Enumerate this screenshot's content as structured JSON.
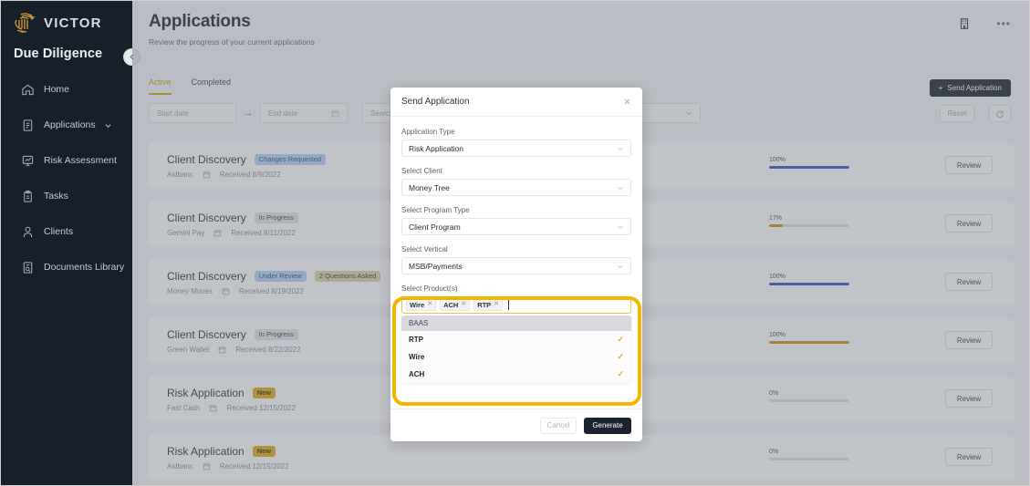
{
  "brand": {
    "logo_text": "VICTOR",
    "product_title": "Due Diligence",
    "gold": "#e7a91b",
    "dark": "#171f2b"
  },
  "sidebar": {
    "items": [
      {
        "label": "Home",
        "icon": "home-icon"
      },
      {
        "label": "Applications",
        "icon": "document-icon",
        "chevron": true
      },
      {
        "label": "Risk Assessment",
        "icon": "presentation-chart-icon"
      },
      {
        "label": "Tasks",
        "icon": "clipboard-icon"
      },
      {
        "label": "Clients",
        "icon": "person-icon"
      },
      {
        "label": "Documents Library",
        "icon": "document-search-icon"
      }
    ]
  },
  "header": {
    "title": "Applications",
    "subtitle": "Review the progress of your current applications",
    "building_icon": "building-icon",
    "overflow": "•••"
  },
  "tabs": [
    {
      "label": "Active",
      "active": true
    },
    {
      "label": "Completed",
      "active": false
    }
  ],
  "filters": {
    "start_date_placeholder": "Start date",
    "end_date_placeholder": "End date",
    "search_placeholder": "Search Client",
    "status_placeholder": "",
    "type_placeholder": "",
    "reset_label": "Reset",
    "refresh_icon": "refresh-icon",
    "send_application_label": "Send Application"
  },
  "rows": [
    {
      "title": "Client Discovery",
      "badges": [
        {
          "text": "Changes Requested",
          "style": "blue"
        }
      ],
      "client": "Aidbanc",
      "received": "Received 8/9/2022",
      "percent": "100%",
      "fill": 100,
      "color": "#2b57c4",
      "review": "Review"
    },
    {
      "title": "Client Discovery",
      "badges": [
        {
          "text": "In Progress",
          "style": "gray"
        }
      ],
      "client": "Gemini Pay",
      "received": "Received 8/11/2022",
      "percent": "17%",
      "fill": 17,
      "color": "#cf9213",
      "review": "Review"
    },
    {
      "title": "Client Discovery",
      "badges": [
        {
          "text": "Under Review",
          "style": "blue"
        },
        {
          "text": "2 Questions Asked",
          "style": "khaki"
        }
      ],
      "client": "Money Moves",
      "received": "Received 8/19/2022",
      "percent": "100%",
      "fill": 100,
      "color": "#2b57c4",
      "review": "Review"
    },
    {
      "title": "Client Discovery",
      "badges": [
        {
          "text": "In Progress",
          "style": "gray"
        }
      ],
      "client": "Green Wallet",
      "received": "Received 8/22/2022",
      "percent": "100%",
      "fill": 100,
      "color": "#cf9213",
      "review": "Review"
    },
    {
      "title": "Risk Application",
      "badges": [
        {
          "text": "New",
          "style": "gold"
        }
      ],
      "client": "Fast Cash",
      "received": "Received 12/15/2022",
      "percent": "0%",
      "fill": 0,
      "color": "#2b57c4",
      "review": "Review"
    },
    {
      "title": "Risk Application",
      "badges": [
        {
          "text": "New",
          "style": "gold"
        }
      ],
      "client": "Aidbanc",
      "received": "Received 12/15/2022",
      "percent": "0%",
      "fill": 0,
      "color": "#2b57c4",
      "review": "Review"
    }
  ],
  "modal": {
    "title": "Send Application",
    "close_icon": "close-icon",
    "fields": [
      {
        "label": "Application Type",
        "value": "Risk Application"
      },
      {
        "label": "Select Client",
        "value": "Money Tree"
      },
      {
        "label": "Select Program Type",
        "value": "Client Program"
      },
      {
        "label": "Select Vertical",
        "value": "MSB/Payments"
      }
    ],
    "products": {
      "label": "Select Product(s)",
      "chips": [
        "Wire",
        "ACH",
        "RTP"
      ],
      "group_header": "BAAS",
      "options": [
        {
          "label": "RTP",
          "selected": true
        },
        {
          "label": "Wire",
          "selected": true
        },
        {
          "label": "ACH",
          "selected": true
        }
      ]
    },
    "cancel_label": "Cancel",
    "generate_label": "Generate"
  }
}
